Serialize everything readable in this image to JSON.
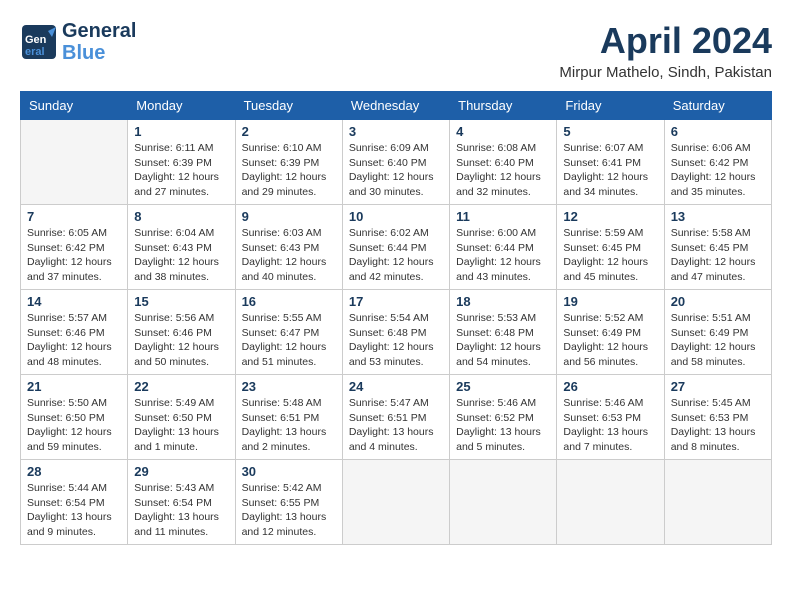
{
  "logo": {
    "line1": "General",
    "line2": "Blue"
  },
  "title": "April 2024",
  "location": "Mirpur Mathelo, Sindh, Pakistan",
  "days_header": [
    "Sunday",
    "Monday",
    "Tuesday",
    "Wednesday",
    "Thursday",
    "Friday",
    "Saturday"
  ],
  "weeks": [
    [
      {
        "num": "",
        "empty": true
      },
      {
        "num": "1",
        "sunrise": "Sunrise: 6:11 AM",
        "sunset": "Sunset: 6:39 PM",
        "daylight": "Daylight: 12 hours and 27 minutes."
      },
      {
        "num": "2",
        "sunrise": "Sunrise: 6:10 AM",
        "sunset": "Sunset: 6:39 PM",
        "daylight": "Daylight: 12 hours and 29 minutes."
      },
      {
        "num": "3",
        "sunrise": "Sunrise: 6:09 AM",
        "sunset": "Sunset: 6:40 PM",
        "daylight": "Daylight: 12 hours and 30 minutes."
      },
      {
        "num": "4",
        "sunrise": "Sunrise: 6:08 AM",
        "sunset": "Sunset: 6:40 PM",
        "daylight": "Daylight: 12 hours and 32 minutes."
      },
      {
        "num": "5",
        "sunrise": "Sunrise: 6:07 AM",
        "sunset": "Sunset: 6:41 PM",
        "daylight": "Daylight: 12 hours and 34 minutes."
      },
      {
        "num": "6",
        "sunrise": "Sunrise: 6:06 AM",
        "sunset": "Sunset: 6:42 PM",
        "daylight": "Daylight: 12 hours and 35 minutes."
      }
    ],
    [
      {
        "num": "7",
        "sunrise": "Sunrise: 6:05 AM",
        "sunset": "Sunset: 6:42 PM",
        "daylight": "Daylight: 12 hours and 37 minutes."
      },
      {
        "num": "8",
        "sunrise": "Sunrise: 6:04 AM",
        "sunset": "Sunset: 6:43 PM",
        "daylight": "Daylight: 12 hours and 38 minutes."
      },
      {
        "num": "9",
        "sunrise": "Sunrise: 6:03 AM",
        "sunset": "Sunset: 6:43 PM",
        "daylight": "Daylight: 12 hours and 40 minutes."
      },
      {
        "num": "10",
        "sunrise": "Sunrise: 6:02 AM",
        "sunset": "Sunset: 6:44 PM",
        "daylight": "Daylight: 12 hours and 42 minutes."
      },
      {
        "num": "11",
        "sunrise": "Sunrise: 6:00 AM",
        "sunset": "Sunset: 6:44 PM",
        "daylight": "Daylight: 12 hours and 43 minutes."
      },
      {
        "num": "12",
        "sunrise": "Sunrise: 5:59 AM",
        "sunset": "Sunset: 6:45 PM",
        "daylight": "Daylight: 12 hours and 45 minutes."
      },
      {
        "num": "13",
        "sunrise": "Sunrise: 5:58 AM",
        "sunset": "Sunset: 6:45 PM",
        "daylight": "Daylight: 12 hours and 47 minutes."
      }
    ],
    [
      {
        "num": "14",
        "sunrise": "Sunrise: 5:57 AM",
        "sunset": "Sunset: 6:46 PM",
        "daylight": "Daylight: 12 hours and 48 minutes."
      },
      {
        "num": "15",
        "sunrise": "Sunrise: 5:56 AM",
        "sunset": "Sunset: 6:46 PM",
        "daylight": "Daylight: 12 hours and 50 minutes."
      },
      {
        "num": "16",
        "sunrise": "Sunrise: 5:55 AM",
        "sunset": "Sunset: 6:47 PM",
        "daylight": "Daylight: 12 hours and 51 minutes."
      },
      {
        "num": "17",
        "sunrise": "Sunrise: 5:54 AM",
        "sunset": "Sunset: 6:48 PM",
        "daylight": "Daylight: 12 hours and 53 minutes."
      },
      {
        "num": "18",
        "sunrise": "Sunrise: 5:53 AM",
        "sunset": "Sunset: 6:48 PM",
        "daylight": "Daylight: 12 hours and 54 minutes."
      },
      {
        "num": "19",
        "sunrise": "Sunrise: 5:52 AM",
        "sunset": "Sunset: 6:49 PM",
        "daylight": "Daylight: 12 hours and 56 minutes."
      },
      {
        "num": "20",
        "sunrise": "Sunrise: 5:51 AM",
        "sunset": "Sunset: 6:49 PM",
        "daylight": "Daylight: 12 hours and 58 minutes."
      }
    ],
    [
      {
        "num": "21",
        "sunrise": "Sunrise: 5:50 AM",
        "sunset": "Sunset: 6:50 PM",
        "daylight": "Daylight: 12 hours and 59 minutes."
      },
      {
        "num": "22",
        "sunrise": "Sunrise: 5:49 AM",
        "sunset": "Sunset: 6:50 PM",
        "daylight": "Daylight: 13 hours and 1 minute."
      },
      {
        "num": "23",
        "sunrise": "Sunrise: 5:48 AM",
        "sunset": "Sunset: 6:51 PM",
        "daylight": "Daylight: 13 hours and 2 minutes."
      },
      {
        "num": "24",
        "sunrise": "Sunrise: 5:47 AM",
        "sunset": "Sunset: 6:51 PM",
        "daylight": "Daylight: 13 hours and 4 minutes."
      },
      {
        "num": "25",
        "sunrise": "Sunrise: 5:46 AM",
        "sunset": "Sunset: 6:52 PM",
        "daylight": "Daylight: 13 hours and 5 minutes."
      },
      {
        "num": "26",
        "sunrise": "Sunrise: 5:46 AM",
        "sunset": "Sunset: 6:53 PM",
        "daylight": "Daylight: 13 hours and 7 minutes."
      },
      {
        "num": "27",
        "sunrise": "Sunrise: 5:45 AM",
        "sunset": "Sunset: 6:53 PM",
        "daylight": "Daylight: 13 hours and 8 minutes."
      }
    ],
    [
      {
        "num": "28",
        "sunrise": "Sunrise: 5:44 AM",
        "sunset": "Sunset: 6:54 PM",
        "daylight": "Daylight: 13 hours and 9 minutes."
      },
      {
        "num": "29",
        "sunrise": "Sunrise: 5:43 AM",
        "sunset": "Sunset: 6:54 PM",
        "daylight": "Daylight: 13 hours and 11 minutes."
      },
      {
        "num": "30",
        "sunrise": "Sunrise: 5:42 AM",
        "sunset": "Sunset: 6:55 PM",
        "daylight": "Daylight: 13 hours and 12 minutes."
      },
      {
        "num": "",
        "empty": true
      },
      {
        "num": "",
        "empty": true
      },
      {
        "num": "",
        "empty": true
      },
      {
        "num": "",
        "empty": true
      }
    ]
  ]
}
